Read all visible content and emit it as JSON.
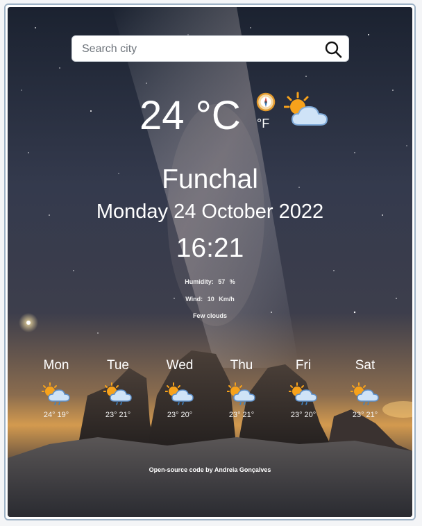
{
  "search": {
    "placeholder": "Search city",
    "value": ""
  },
  "current": {
    "temperature": "24",
    "unit_celsius": "°C",
    "unit_fahrenheit": "°F",
    "unit_toggle_icon": "compass-icon",
    "condition_icon": "sun-behind-cloud-icon"
  },
  "location": {
    "city": "Funchal",
    "date": "Monday 24 October 2022",
    "time": "16:21"
  },
  "details": {
    "humidity_label": "Humidity:",
    "humidity_value": "57",
    "humidity_unit": "%",
    "wind_label": "Wind:",
    "wind_value": "10",
    "wind_unit": "Km/h",
    "description": "Few clouds"
  },
  "forecast": [
    {
      "day": "Mon",
      "temps": "24° 19°",
      "icon": "sun-cloud-rain-icon"
    },
    {
      "day": "Tue",
      "temps": "23° 21°",
      "icon": "sun-cloud-rain-icon"
    },
    {
      "day": "Wed",
      "temps": "23° 20°",
      "icon": "sun-cloud-rain-icon"
    },
    {
      "day": "Thu",
      "temps": "23° 21°",
      "icon": "sun-cloud-rain-icon"
    },
    {
      "day": "Fri",
      "temps": "23° 20°",
      "icon": "sun-cloud-rain-icon"
    },
    {
      "day": "Sat",
      "temps": "23° 21°",
      "icon": "sun-cloud-rain-icon"
    }
  ],
  "footer": {
    "link_text": "Open-source code",
    "by_text": "by Andreia Gonçalves"
  },
  "colors": {
    "sky_top": "#1b2230",
    "sky_mid": "#3a3f52",
    "horizon_glow": "#e0a44a",
    "rock": "#2a2522",
    "sun": "#f7a21b",
    "cloud": "#bcd6f2",
    "rain": "#3b82c4"
  }
}
